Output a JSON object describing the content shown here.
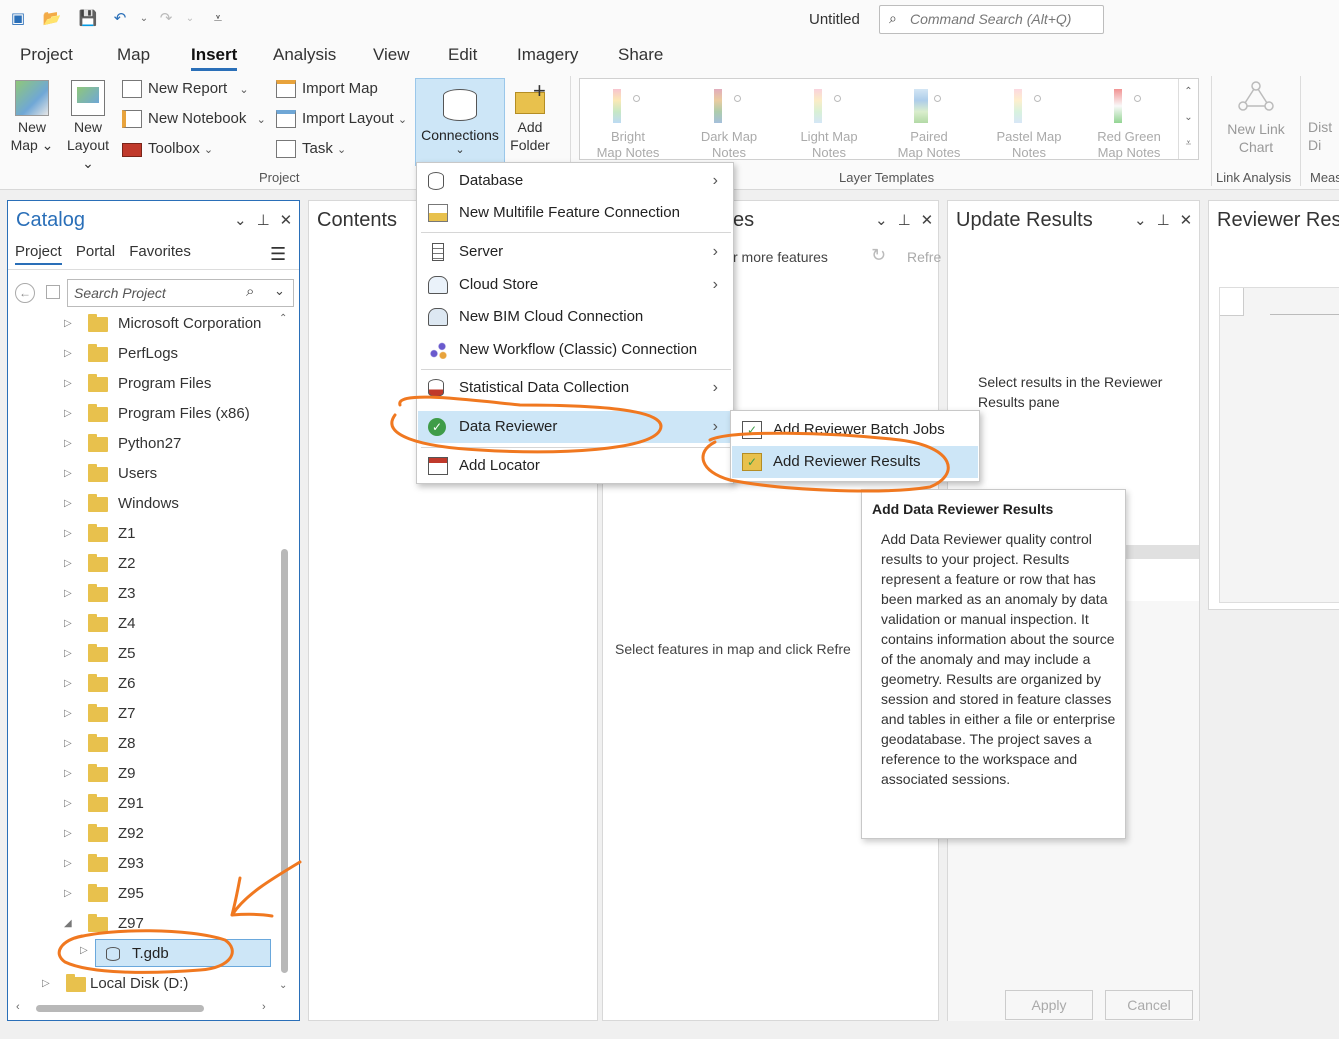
{
  "titlebar": {
    "doc_title": "Untitled",
    "search_placeholder": "Command Search (Alt+Q)"
  },
  "tabs": [
    "Project",
    "Map",
    "Insert",
    "Analysis",
    "View",
    "Edit",
    "Imagery",
    "Share"
  ],
  "active_tab": "Insert",
  "ribbon": {
    "project_group": {
      "label": "Project",
      "new_map": "New\nMap",
      "new_map_line1": "New",
      "new_map_line2": "Map",
      "new_layout_line1": "New",
      "new_layout_line2": "Layout",
      "new_report": "New Report",
      "new_notebook": "New Notebook",
      "toolbox": "Toolbox",
      "import_map": "Import Map",
      "import_layout": "Import Layout",
      "task": "Task",
      "connections": "Connections",
      "add_folder_line1": "Add",
      "add_folder_line2": "Folder"
    },
    "layer_templates": {
      "label": "Layer Templates",
      "items": [
        {
          "line1": "Bright",
          "line2": "Map Notes"
        },
        {
          "line1": "Dark Map",
          "line2": "Notes"
        },
        {
          "line1": "Light Map",
          "line2": "Notes"
        },
        {
          "line1": "Paired",
          "line2": "Map Notes"
        },
        {
          "line1": "Pastel Map",
          "line2": "Notes"
        },
        {
          "line1": "Red Green",
          "line2": "Map Notes"
        }
      ]
    },
    "link_analysis": {
      "label": "Link Analysis",
      "new_link_chart_line1": "New Link",
      "new_link_chart_line2": "Chart",
      "dist_line1": "Dist",
      "dist_line2": "Di",
      "meas": "Meas"
    }
  },
  "catalog": {
    "title": "Catalog",
    "tabs": [
      "Project",
      "Portal",
      "Favorites"
    ],
    "search_placeholder": "Search Project",
    "items": [
      "Microsoft Corporation",
      "PerfLogs",
      "Program Files",
      "Program Files (x86)",
      "Python27",
      "Users",
      "Windows",
      "Z1",
      "Z2",
      "Z3",
      "Z4",
      "Z5",
      "Z6",
      "Z7",
      "Z8",
      "Z9",
      "Z91",
      "Z92",
      "Z93",
      "Z95",
      "Z97"
    ],
    "child_item": "T.gdb",
    "bottom_item": "Local Disk (D:)"
  },
  "contents": {
    "title": "Contents"
  },
  "attributes_pane": {
    "title_fragment": "es",
    "more_features": "r more features",
    "refresh_fragment": "Refre",
    "message": "Select features in map and click Refre"
  },
  "update_results": {
    "title": "Update Results",
    "message": "Select results in the Reviewer Results pane",
    "apply": "Apply",
    "cancel": "Cancel"
  },
  "reviewer_results": {
    "title": "Reviewer Resu"
  },
  "connections_menu": {
    "items": [
      {
        "label": "Database",
        "submenu": true
      },
      {
        "label": "New Multifile Feature Connection",
        "submenu": false
      },
      {
        "label": "Server",
        "submenu": true
      },
      {
        "label": "Cloud Store",
        "submenu": true
      },
      {
        "label": "New BIM Cloud Connection",
        "submenu": false
      },
      {
        "label": "New Workflow (Classic) Connection",
        "submenu": false
      },
      {
        "label": "Statistical Data Collection",
        "submenu": true
      },
      {
        "label": "Data Reviewer",
        "submenu": true
      },
      {
        "label": "Add Locator",
        "submenu": false
      }
    ],
    "submenu_items": [
      "Add Reviewer Batch Jobs",
      "Add Reviewer Results"
    ]
  },
  "tooltip": {
    "title": "Add Data Reviewer Results",
    "body": "Add Data Reviewer quality control results to your project. Results represent a feature or row that has been marked as an anomaly by data validation or manual inspection.  It contains information about the source of the anomaly and may include a geometry. Results are organized by session and stored in feature classes and tables in either a file or enterprise geodatabase.  The project saves a reference to the workspace and associated sessions."
  },
  "colors": {
    "accent": "#2a6fb8",
    "highlight": "#cde6f7",
    "annotation": "#f07820"
  }
}
